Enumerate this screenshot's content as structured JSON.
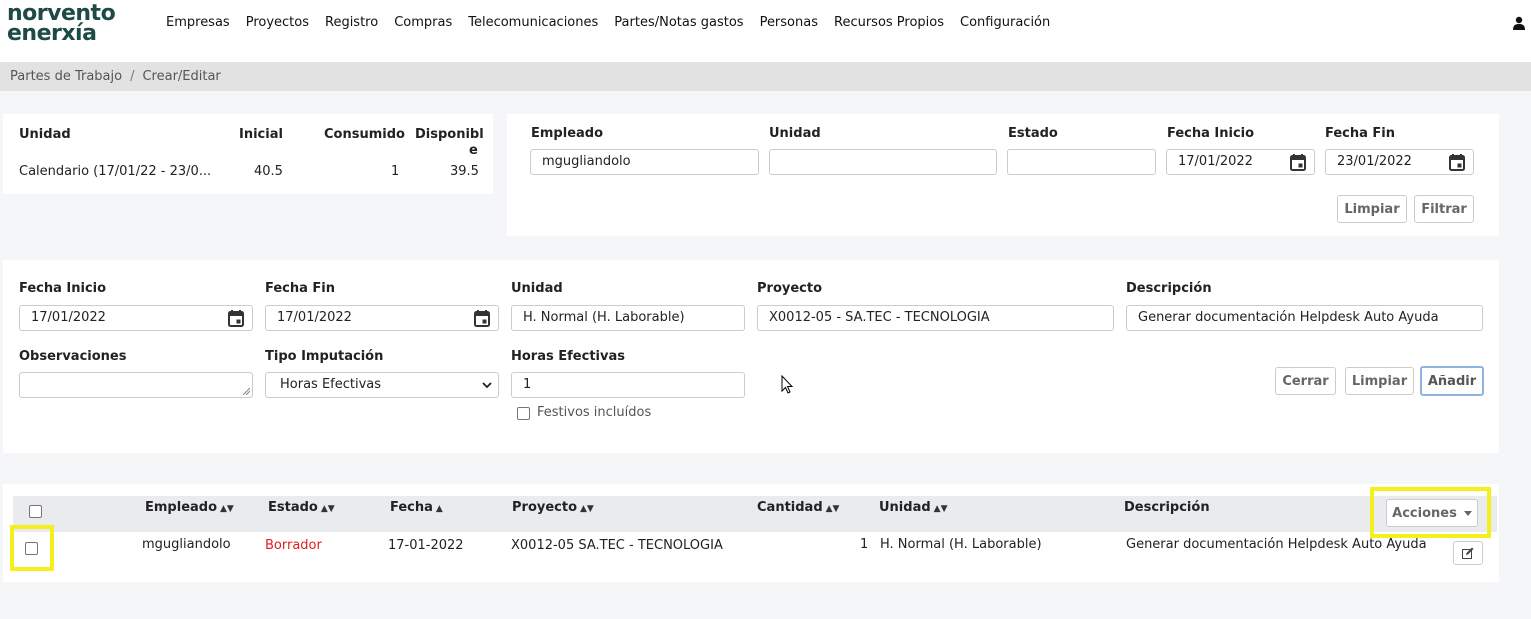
{
  "logo": {
    "line1": "norvento",
    "line2": "enerxía"
  },
  "nav": [
    "Empresas",
    "Proyectos",
    "Registro",
    "Compras",
    "Telecomunicaciones",
    "Partes/Notas gastos",
    "Personas",
    "Recursos Propios",
    "Configuración"
  ],
  "breadcrumb": {
    "item1": "Partes de Trabajo",
    "item2": "Crear/Editar",
    "separator": "/"
  },
  "summary": {
    "headers": {
      "unidad": "Unidad",
      "inicial": "Inicial",
      "consumido": "Consumido",
      "disponible_a": "Disponibl",
      "disponible_b": "e"
    },
    "row": {
      "unidad": "Calendario (17/01/22 - 23/0...",
      "inicial": "40.5",
      "consumido": "1",
      "disponible": "39.5"
    }
  },
  "filter": {
    "empleado_label": "Empleado",
    "empleado_value": "mgugliandolo",
    "unidad_label": "Unidad",
    "unidad_value": "",
    "estado_label": "Estado",
    "estado_value": "",
    "fecha_inicio_label": "Fecha Inicio",
    "fecha_inicio_value": "17/01/2022",
    "fecha_fin_label": "Fecha Fin",
    "fecha_fin_value": "23/01/2022",
    "limpiar": "Limpiar",
    "filtrar": "Filtrar"
  },
  "form": {
    "fecha_inicio_label": "Fecha Inicio",
    "fecha_inicio_value": "17/01/2022",
    "fecha_fin_label": "Fecha Fin",
    "fecha_fin_value": "17/01/2022",
    "unidad_label": "Unidad",
    "unidad_value": "H. Normal (H. Laborable)",
    "proyecto_label": "Proyecto",
    "proyecto_value": "X0012-05 - SA.TEC - TECNOLOGIA",
    "descripcion_label": "Descripción",
    "descripcion_value": "Generar documentación Helpdesk Auto Ayuda",
    "observaciones_label": "Observaciones",
    "observaciones_value": "",
    "tipo_label": "Tipo Imputación",
    "tipo_value": "Horas Efectivas",
    "horas_label": "Horas Efectivas",
    "horas_value": "1",
    "festivos_label": "Festivos incluídos",
    "cerrar": "Cerrar",
    "limpiar": "Limpiar",
    "anadir": "Añadir"
  },
  "table": {
    "headers": {
      "empleado": "Empleado",
      "estado": "Estado",
      "fecha": "Fecha",
      "proyecto": "Proyecto",
      "cantidad": "Cantidad",
      "unidad": "Unidad",
      "descripcion": "Descripción"
    },
    "acciones": "Acciones",
    "rows": [
      {
        "empleado": "mgugliandolo",
        "estado": "Borrador",
        "fecha": "17-01-2022",
        "proyecto": "X0012-05 SA.TEC - TECNOLOGIA",
        "cantidad": "1",
        "unidad": "H. Normal (H. Laborable)",
        "descripcion": "Generar documentación Helpdesk Auto Ayuda"
      }
    ]
  },
  "colors": {
    "brand": "#1d4a47",
    "status_borrador": "#e02020",
    "highlight": "#f5ef1c",
    "primary_border": "#8fb3e0"
  }
}
